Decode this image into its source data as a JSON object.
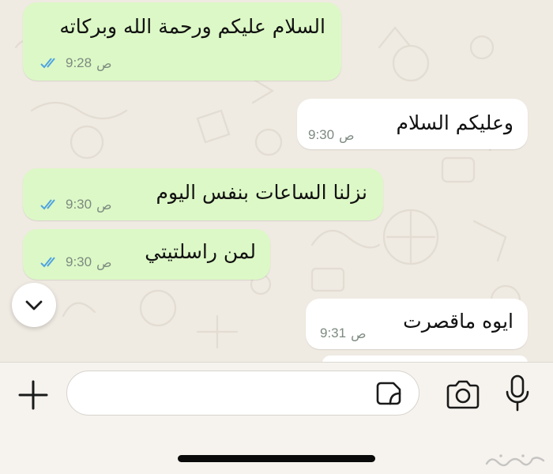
{
  "colors": {
    "outgoing_bubble": "#dcf8c6",
    "incoming_bubble": "#ffffff",
    "read_ticks": "#4fa3e0",
    "chat_background": "#efeae2"
  },
  "messages": [
    {
      "direction": "outgoing",
      "text": "السلام عليكم ورحمة الله وبركاته",
      "time": "9:28",
      "ampm": "ص",
      "status": "read"
    },
    {
      "direction": "incoming",
      "text": "وعليكم السلام",
      "time": "9:30",
      "ampm": "ص"
    },
    {
      "direction": "outgoing",
      "text": "نزلنا الساعات بنفس اليوم",
      "time": "9:30",
      "ampm": "ص",
      "status": "read"
    },
    {
      "direction": "outgoing",
      "text": "لمن راسلتيتي",
      "time": "9:30",
      "ampm": "ص",
      "status": "read"
    },
    {
      "direction": "incoming",
      "text": "ايوه ماقصرت",
      "time": "9:31",
      "ampm": "ص"
    }
  ],
  "composer": {
    "input_value": "",
    "icons": [
      "plus-icon",
      "sticker-icon",
      "camera-icon",
      "microphone-icon"
    ]
  },
  "scroll_button_icon": "chevron-down-icon"
}
